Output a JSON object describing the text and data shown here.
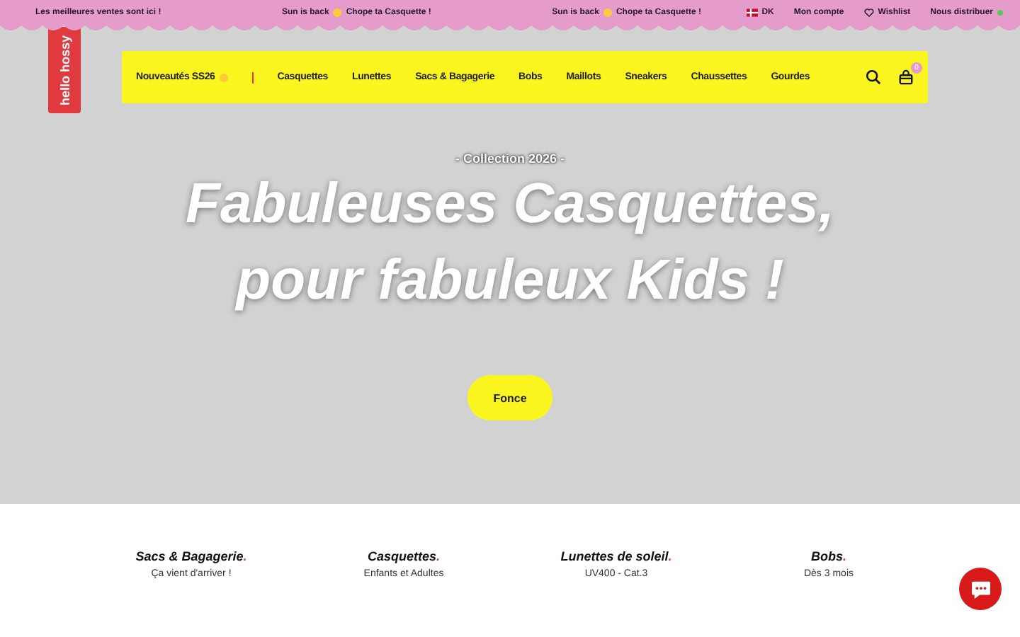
{
  "announcement_bar": {
    "messages": [
      "Les meilleures ventes sont ici !",
      "Sun is back",
      "Chope ta Casquette !",
      "Sun is back",
      "Chope ta Casquette !"
    ],
    "country": "DK",
    "links": [
      {
        "label": "Mon compte",
        "kind": "account"
      },
      {
        "label": "Wishlist",
        "kind": "wishlist"
      },
      {
        "label": "Nous distribuer",
        "kind": "distributor"
      }
    ]
  },
  "logo": "hello hossy",
  "nav": {
    "items": [
      {
        "label": "Nouveautés SS26",
        "kind": "new"
      },
      {
        "label": "Casquettes",
        "kind": "link"
      },
      {
        "label": "Lunettes",
        "kind": "link"
      },
      {
        "label": "Sacs & Bagagerie",
        "kind": "link"
      },
      {
        "label": "Bobs",
        "kind": "link"
      },
      {
        "label": "Maillots",
        "kind": "link"
      },
      {
        "label": "Sneakers",
        "kind": "link"
      },
      {
        "label": "Chaussettes",
        "kind": "link"
      },
      {
        "label": "Gourdes",
        "kind": "link"
      }
    ],
    "cart_count": "0"
  },
  "hero": {
    "eyebrow": "- Collection 2026 -",
    "headline": [
      "Fabuleuses Casquettes,",
      "pour fabuleux Kids !"
    ],
    "button": "Fonce"
  },
  "categories": [
    {
      "title": "Sacs & Bagagerie.",
      "subtitle": "Ça vient d'arriver !"
    },
    {
      "title": "Casquettes.",
      "subtitle": "Enfants et Adultes"
    },
    {
      "title": "Lunettes de soleil.",
      "subtitle": "UV400 - Cat.3"
    },
    {
      "title": "Bobs.",
      "subtitle": "Dès 3 mois"
    }
  ]
}
